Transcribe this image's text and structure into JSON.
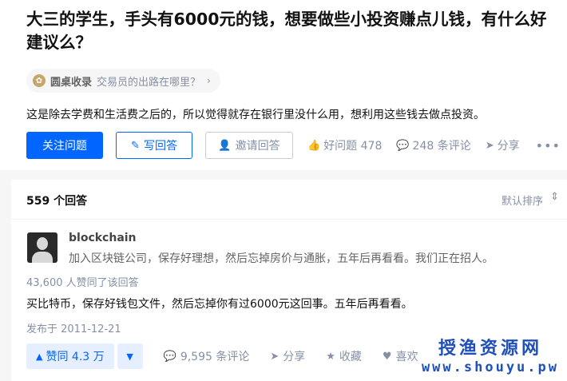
{
  "question": {
    "title": "大三的学生，手头有6000元的钱，想要做些小投资赚点儿钱，有什么好建议么？",
    "roundtable": {
      "name": "圆桌收录",
      "topic": "交易员的出路在哪里？"
    },
    "detail": "这是除去学费和生活费之后的，所以觉得就存在银行里没什么用，想利用这些钱去做点投资。",
    "actions": {
      "follow_label": "关注问题",
      "write_label": "写回答",
      "invite_label": "邀请回答",
      "good_question_label": "好问题 478",
      "comments_label": "248 条评论",
      "share_label": "分享"
    }
  },
  "answers": {
    "count_label": "559 个回答",
    "sort_label": "默认排序",
    "first": {
      "author_name": "blockchain",
      "author_bio": "加入区块链公司，保存好理想，然后忘掉房价与通胀，五年后再看看。我们正在招人。",
      "upvoted_by": "43,600 人赞同了该回答",
      "content": "买比特币，保存好钱包文件，然后忘掉你有过6000元这回事。五年后再看看。",
      "published": "发布于 2011-12-21",
      "actions": {
        "upvote_label": "赞同 4.3 万",
        "comments_label": "9,595 条评论",
        "share_label": "分享",
        "favorite_label": "收藏",
        "like_label": "喜欢"
      }
    }
  },
  "watermark": {
    "cn": "授渔资源网",
    "url": "www.shouyu.pw"
  },
  "colors": {
    "brand_blue": "#0066ff",
    "muted_gray": "#8590a6",
    "watermark_blue": "#1f4fb8"
  }
}
